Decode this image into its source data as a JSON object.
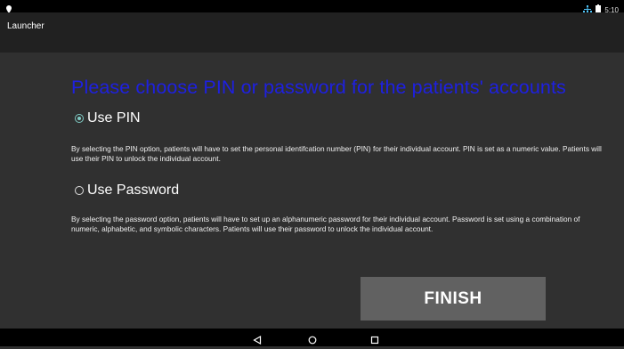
{
  "status_bar": {
    "time": "5:10",
    "left_icon": "location-pin-icon",
    "right_icons": [
      "network-icon",
      "battery-icon"
    ]
  },
  "action_bar": {
    "title": "Launcher"
  },
  "main": {
    "heading": "Please choose PIN or password for the patients' accounts",
    "options": [
      {
        "label": "Use PIN",
        "checked": true,
        "description": "By selecting the PIN option, patients will have to set the personal identifcation number (PIN) for their individual account. PIN is set as a numeric value. Patients will use their PIN to unlock the individual account."
      },
      {
        "label": "Use Password",
        "checked": false,
        "description": "By selecting the password option, patients will have to set up an alphanumeric password for their individual account. Password is set using a combination of numeric, alphabetic, and symbolic characters. Patients will use their password to unlock the individual account."
      }
    ],
    "finish_label": "FINISH"
  },
  "nav_bar": {
    "buttons": [
      "back-icon",
      "home-icon",
      "recents-icon"
    ]
  },
  "colors": {
    "heading": "#1e20e0",
    "radio_accent": "#80cbc4",
    "background": "#303030",
    "action_bar": "#212121",
    "button": "#616161"
  }
}
